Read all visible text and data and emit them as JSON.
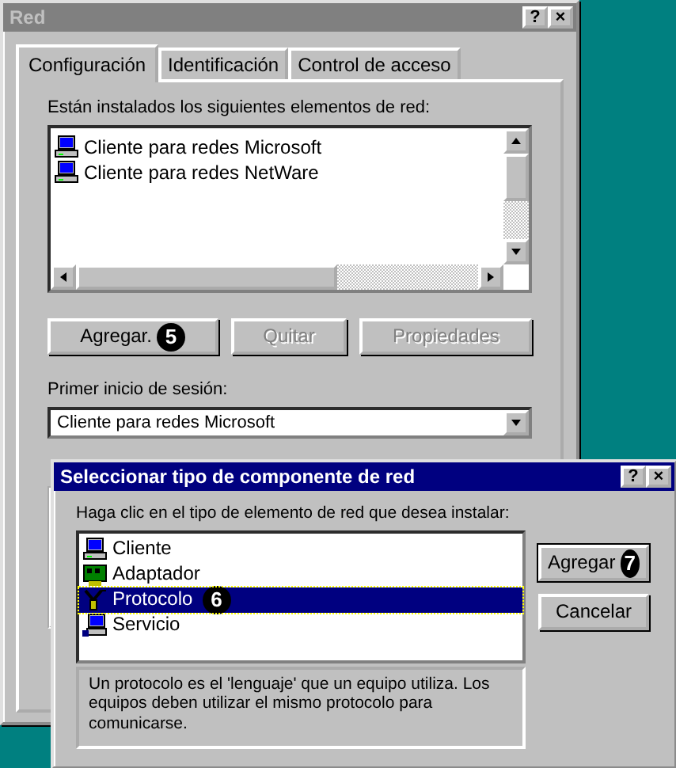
{
  "main_window": {
    "title": "Red",
    "active": false,
    "title_buttons": [
      "?",
      "×"
    ],
    "tabs": [
      {
        "label": "Configuración",
        "selected": true
      },
      {
        "label": "Identificación",
        "selected": false
      },
      {
        "label": "Control de acceso",
        "selected": false
      }
    ],
    "installed_label": "Están instalados los siguientes elementos de red:",
    "installed": [
      {
        "kind": "client",
        "label": "Cliente para redes Microsoft"
      },
      {
        "kind": "client",
        "label": "Cliente para redes NetWare"
      }
    ],
    "buttons": [
      {
        "label": "Agregar.",
        "disabled": false,
        "callout": "5"
      },
      {
        "label": "Quitar",
        "disabled": true
      },
      {
        "label": "Propiedades",
        "disabled": true
      }
    ],
    "logon_label": "Primer inicio de sesión:",
    "logon_value": "Cliente para redes Microsoft"
  },
  "dialog": {
    "title": "Seleccionar tipo de componente de red",
    "active": true,
    "title_buttons": [
      "?",
      "×"
    ],
    "prompt": "Haga clic en el tipo de elemento de red que desea instalar:",
    "items": [
      {
        "kind": "client",
        "label": "Cliente",
        "selected": false
      },
      {
        "kind": "adapter",
        "label": "Adaptador",
        "selected": false
      },
      {
        "kind": "protocol",
        "label": "Protocolo",
        "selected": true,
        "callout": "6"
      },
      {
        "kind": "service",
        "label": "Servicio",
        "selected": false
      }
    ],
    "description": "Un protocolo es el 'lenguaje' que un equipo utiliza. Los equipos deben utilizar el mismo protocolo para comunicarse.",
    "buttons": [
      {
        "label": "Agregar",
        "default": true,
        "callout": "7"
      },
      {
        "label": "Cancelar",
        "default": false
      }
    ]
  }
}
